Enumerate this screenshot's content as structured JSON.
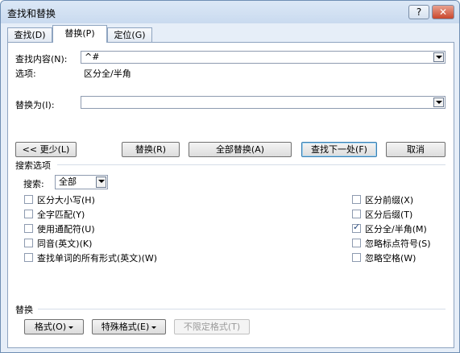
{
  "window": {
    "title": "查找和替换",
    "help_label": "?",
    "close_label": "✕"
  },
  "tabs": [
    {
      "label": "查找(D)",
      "active": false
    },
    {
      "label": "替换(P)",
      "active": true
    },
    {
      "label": "定位(G)",
      "active": false
    }
  ],
  "find": {
    "label": "查找内容(N):",
    "value": "^#"
  },
  "options": {
    "label": "选项:",
    "value": "区分全/半角"
  },
  "replace": {
    "label": "替换为(I):",
    "value": ""
  },
  "buttons": {
    "less": "<< 更少(L)",
    "replace": "替换(R)",
    "replace_all": "全部替换(A)",
    "find_next": "查找下一处(F)",
    "cancel": "取消"
  },
  "search_options": {
    "section_label": "搜索选项",
    "search_label": "搜索:",
    "search_value": "全部",
    "left_checks": [
      {
        "label": "区分大小写(H)",
        "checked": false
      },
      {
        "label": "全字匹配(Y)",
        "checked": false
      },
      {
        "label": "使用通配符(U)",
        "checked": false
      },
      {
        "label": "同音(英文)(K)",
        "checked": false
      },
      {
        "label": "查找单词的所有形式(英文)(W)",
        "checked": false
      }
    ],
    "right_checks": [
      {
        "label": "区分前缀(X)",
        "checked": false
      },
      {
        "label": "区分后缀(T)",
        "checked": false
      },
      {
        "label": "区分全/半角(M)",
        "checked": true
      },
      {
        "label": "忽略标点符号(S)",
        "checked": false
      },
      {
        "label": "忽略空格(W)",
        "checked": false
      }
    ]
  },
  "replace_section": {
    "label": "替换",
    "format": "格式(O)",
    "special": "特殊格式(E)",
    "no_format": "不限定格式(T)"
  }
}
